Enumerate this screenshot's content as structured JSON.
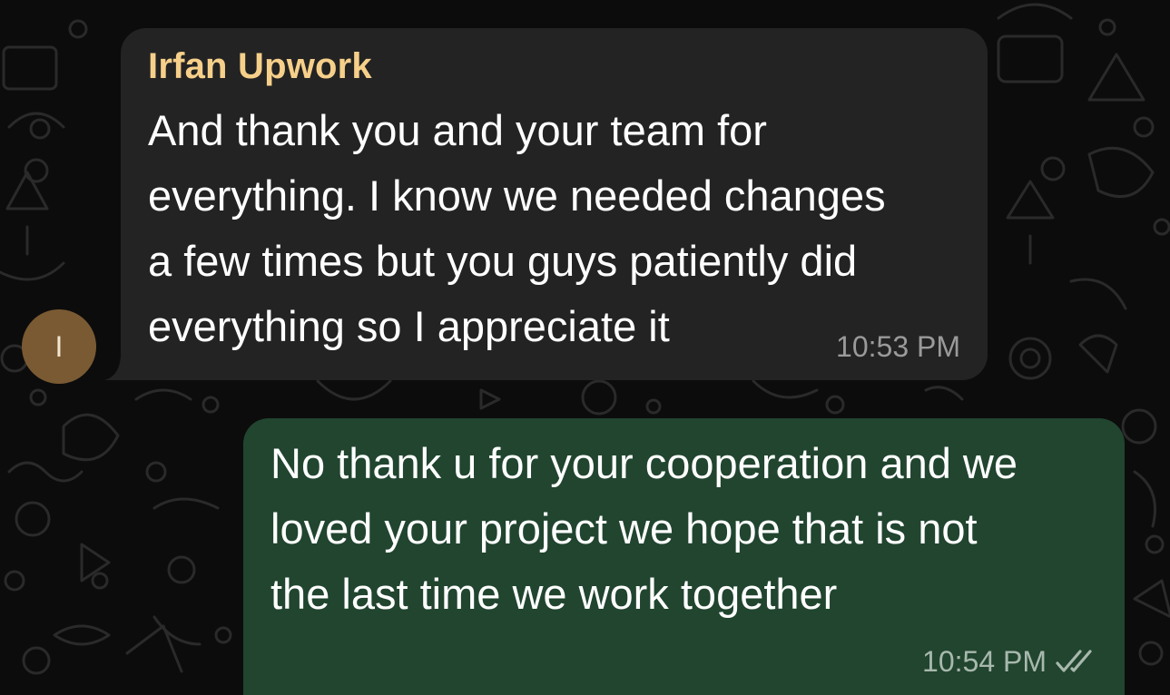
{
  "incoming_message": {
    "avatar_initial": "I",
    "sender_name": "Irfan Upwork",
    "lines": [
      "And thank you and your team for",
      "everything. I know we needed changes",
      "a few times but you guys patiently did",
      "everything so I appreciate it"
    ],
    "time": "10:53 PM"
  },
  "outgoing_message": {
    "lines": [
      "No thank u for your cooperation and we",
      "loved your project we hope that is not",
      "the last time we work together"
    ],
    "time": "10:54 PM",
    "status_icon": "double-check-icon"
  },
  "colors": {
    "background": "#0c0c0c",
    "incoming_bubble": "#232323",
    "outgoing_bubble": "#21452f",
    "sender_name": "#f6d08a",
    "avatar": "#7a5a33"
  }
}
